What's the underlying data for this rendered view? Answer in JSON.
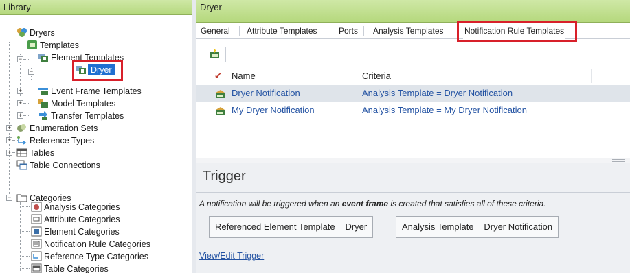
{
  "library": {
    "title": "Library",
    "tree": [
      {
        "label": "Dryers",
        "icon": "database-icon"
      },
      {
        "label": "Templates",
        "icon": "templates-icon"
      },
      {
        "label": "Element Templates",
        "icon": "element-templates-icon"
      },
      {
        "label": "Dryer",
        "icon": "element-template-icon",
        "selected": true
      },
      {
        "label": "Event Frame Templates",
        "icon": "event-frame-templates-icon"
      },
      {
        "label": "Model Templates",
        "icon": "model-templates-icon"
      },
      {
        "label": "Transfer Templates",
        "icon": "transfer-templates-icon"
      },
      {
        "label": "Enumeration Sets",
        "icon": "enumeration-sets-icon"
      },
      {
        "label": "Reference Types",
        "icon": "reference-types-icon"
      },
      {
        "label": "Tables",
        "icon": "tables-icon"
      },
      {
        "label": "Table Connections",
        "icon": "table-connections-icon"
      },
      {
        "label": "Categories",
        "icon": "folder-icon"
      },
      {
        "label": "Analysis Categories",
        "icon": "analysis-categories-icon"
      },
      {
        "label": "Attribute Categories",
        "icon": "attribute-categories-icon"
      },
      {
        "label": "Element Categories",
        "icon": "element-categories-icon"
      },
      {
        "label": "Notification Rule Categories",
        "icon": "notification-rule-categories-icon"
      },
      {
        "label": "Reference Type Categories",
        "icon": "reference-type-categories-icon"
      },
      {
        "label": "Table Categories",
        "icon": "table-categories-icon"
      }
    ]
  },
  "detail": {
    "title": "Dryer",
    "tabs": [
      {
        "label": "General"
      },
      {
        "label": "Attribute Templates"
      },
      {
        "label": "Ports"
      },
      {
        "label": "Analysis Templates"
      },
      {
        "label": "Notification Rule Templates",
        "active": true
      }
    ],
    "toolbar": {
      "new_icon": "new-notification-rule-icon"
    },
    "grid": {
      "columns": [
        "Name",
        "Criteria"
      ],
      "rows": [
        {
          "name": "Dryer Notification",
          "criteria": "Analysis Template = Dryer Notification",
          "selected": true
        },
        {
          "name": "My Dryer Notification",
          "criteria": "Analysis Template = My Dryer Notification",
          "selected": false
        }
      ]
    },
    "trigger": {
      "title": "Trigger",
      "desc_before": "A notification will be triggered when an ",
      "desc_bold": "event frame",
      "desc_after": " is created that satisfies all of these criteria.",
      "chips": [
        "Referenced Element Template = Dryer",
        "Analysis Template = Dryer Notification"
      ],
      "link": "View/Edit Trigger"
    }
  },
  "colors": {
    "header_green": "#b5d87d",
    "highlight_red": "#d8202a",
    "link_blue": "#2453a3",
    "selection_blue": "#1f6fd1",
    "row_selected": "#dfe4ea"
  }
}
